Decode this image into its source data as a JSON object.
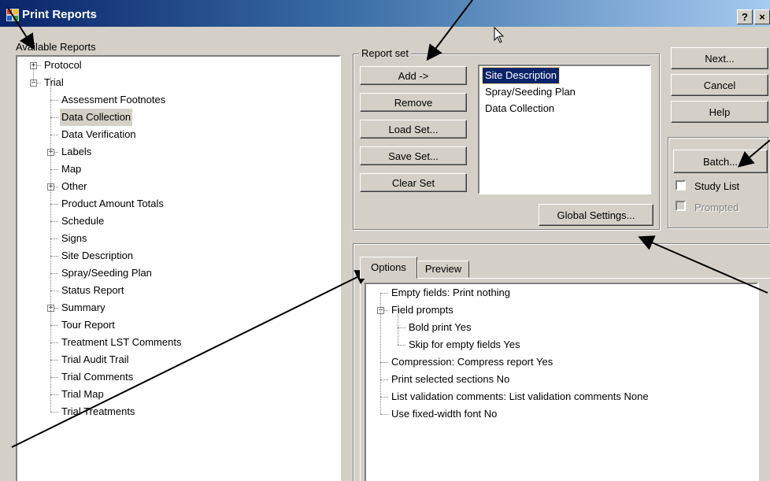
{
  "window": {
    "title": "Print Reports",
    "help_btn": "?",
    "close_btn": "×"
  },
  "available_reports": {
    "label": "Available Reports",
    "tree": [
      {
        "label": "Protocol",
        "level": 0,
        "expander": "+"
      },
      {
        "label": "Trial",
        "level": 0,
        "expander": "−"
      },
      {
        "label": "Assessment Footnotes",
        "level": 1,
        "expander": ""
      },
      {
        "label": "Data Collection",
        "level": 1,
        "expander": "",
        "selected": true
      },
      {
        "label": "Data Verification",
        "level": 1,
        "expander": ""
      },
      {
        "label": "Labels",
        "level": 1,
        "expander": "+"
      },
      {
        "label": "Map",
        "level": 1,
        "expander": ""
      },
      {
        "label": "Other",
        "level": 1,
        "expander": "+"
      },
      {
        "label": "Product Amount Totals",
        "level": 1,
        "expander": ""
      },
      {
        "label": "Schedule",
        "level": 1,
        "expander": ""
      },
      {
        "label": "Signs",
        "level": 1,
        "expander": ""
      },
      {
        "label": "Site Description",
        "level": 1,
        "expander": ""
      },
      {
        "label": "Spray/Seeding Plan",
        "level": 1,
        "expander": ""
      },
      {
        "label": "Status Report",
        "level": 1,
        "expander": ""
      },
      {
        "label": "Summary",
        "level": 1,
        "expander": "+"
      },
      {
        "label": "Tour Report",
        "level": 1,
        "expander": ""
      },
      {
        "label": "Treatment LST Comments",
        "level": 1,
        "expander": ""
      },
      {
        "label": "Trial Audit Trail",
        "level": 1,
        "expander": ""
      },
      {
        "label": "Trial Comments",
        "level": 1,
        "expander": ""
      },
      {
        "label": "Trial Map",
        "level": 1,
        "expander": ""
      },
      {
        "label": "Trial Treatments",
        "level": 1,
        "expander": ""
      }
    ]
  },
  "report_set": {
    "label": "Report set",
    "buttons": {
      "add": "Add ->",
      "remove": "Remove",
      "load": "Load Set...",
      "save": "Save Set...",
      "clear": "Clear Set"
    },
    "items": [
      "Site Description",
      "Spray/Seeding Plan",
      "Data Collection"
    ],
    "global_settings": "Global Settings..."
  },
  "side_buttons": {
    "next": "Next...",
    "cancel": "Cancel",
    "help": "Help",
    "batch": "Batch..."
  },
  "checks": {
    "study_list": "Study List",
    "prompted": "Prompted"
  },
  "tabs": {
    "options": "Options",
    "preview": "Preview"
  },
  "options_tree": [
    {
      "label": "Empty fields: Print nothing",
      "level": 0,
      "expander": ""
    },
    {
      "label": "Field prompts",
      "level": 0,
      "expander": "−"
    },
    {
      "label": "Bold print    Yes",
      "level": 1,
      "expander": ""
    },
    {
      "label": "Skip for empty fields    Yes",
      "level": 1,
      "expander": ""
    },
    {
      "label": "Compression: Compress report    Yes",
      "level": 0,
      "expander": ""
    },
    {
      "label": "Print selected sections    No",
      "level": 0,
      "expander": ""
    },
    {
      "label": "List validation comments: List validation comments  None",
      "level": 0,
      "expander": ""
    },
    {
      "label": "Use fixed-width font    No",
      "level": 0,
      "expander": ""
    }
  ],
  "colors": {
    "title_start": "#0a246a",
    "title_end": "#a6caf0",
    "selection": "#0a246a",
    "face": "#d4d0c8"
  }
}
